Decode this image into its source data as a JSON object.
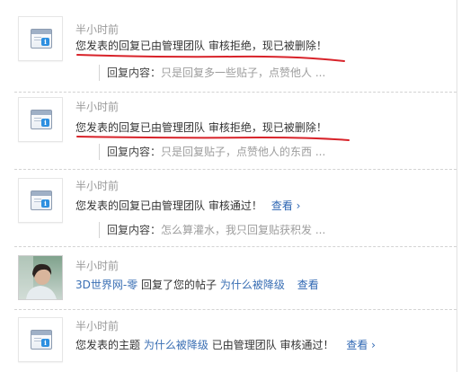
{
  "notices": [
    {
      "time": "半小时前",
      "text": "您发表的回复已由管理团队 审核拒绝，现已被删除！",
      "quote_label": "回复内容：",
      "quote_text": "只是回复多一些贴子，点赞他人 ..."
    },
    {
      "time": "半小时前",
      "text": "您发表的回复已由管理团队 审核拒绝，现已被删除！",
      "quote_label": "回复内容：",
      "quote_text": "只是回复贴子，点赞他人的东西 ..."
    },
    {
      "time": "半小时前",
      "text": "您发表的回复已由管理团队 审核通过！",
      "view_label": "查看 ›",
      "quote_label": "回复内容：",
      "quote_text": "怎么算灌水，我只回复贴获积发 ..."
    },
    {
      "time": "半小时前",
      "user": "3D世界网-零",
      "action": "回复了您的帖子",
      "thread": "为什么被降级",
      "view_label": "查看"
    },
    {
      "time": "半小时前",
      "text_before": "您发表的主题",
      "thread": "为什么被降级",
      "text_after": "已由管理团队 审核通过！",
      "view_label": "查看 ›"
    }
  ],
  "icons": {
    "system_notice": "window-info-icon",
    "avatar": "user-avatar"
  },
  "colors": {
    "link": "#3a6fb4",
    "annotation": "#d8232a",
    "separator": "#d3d3d3",
    "muted": "#9a9a9a"
  }
}
